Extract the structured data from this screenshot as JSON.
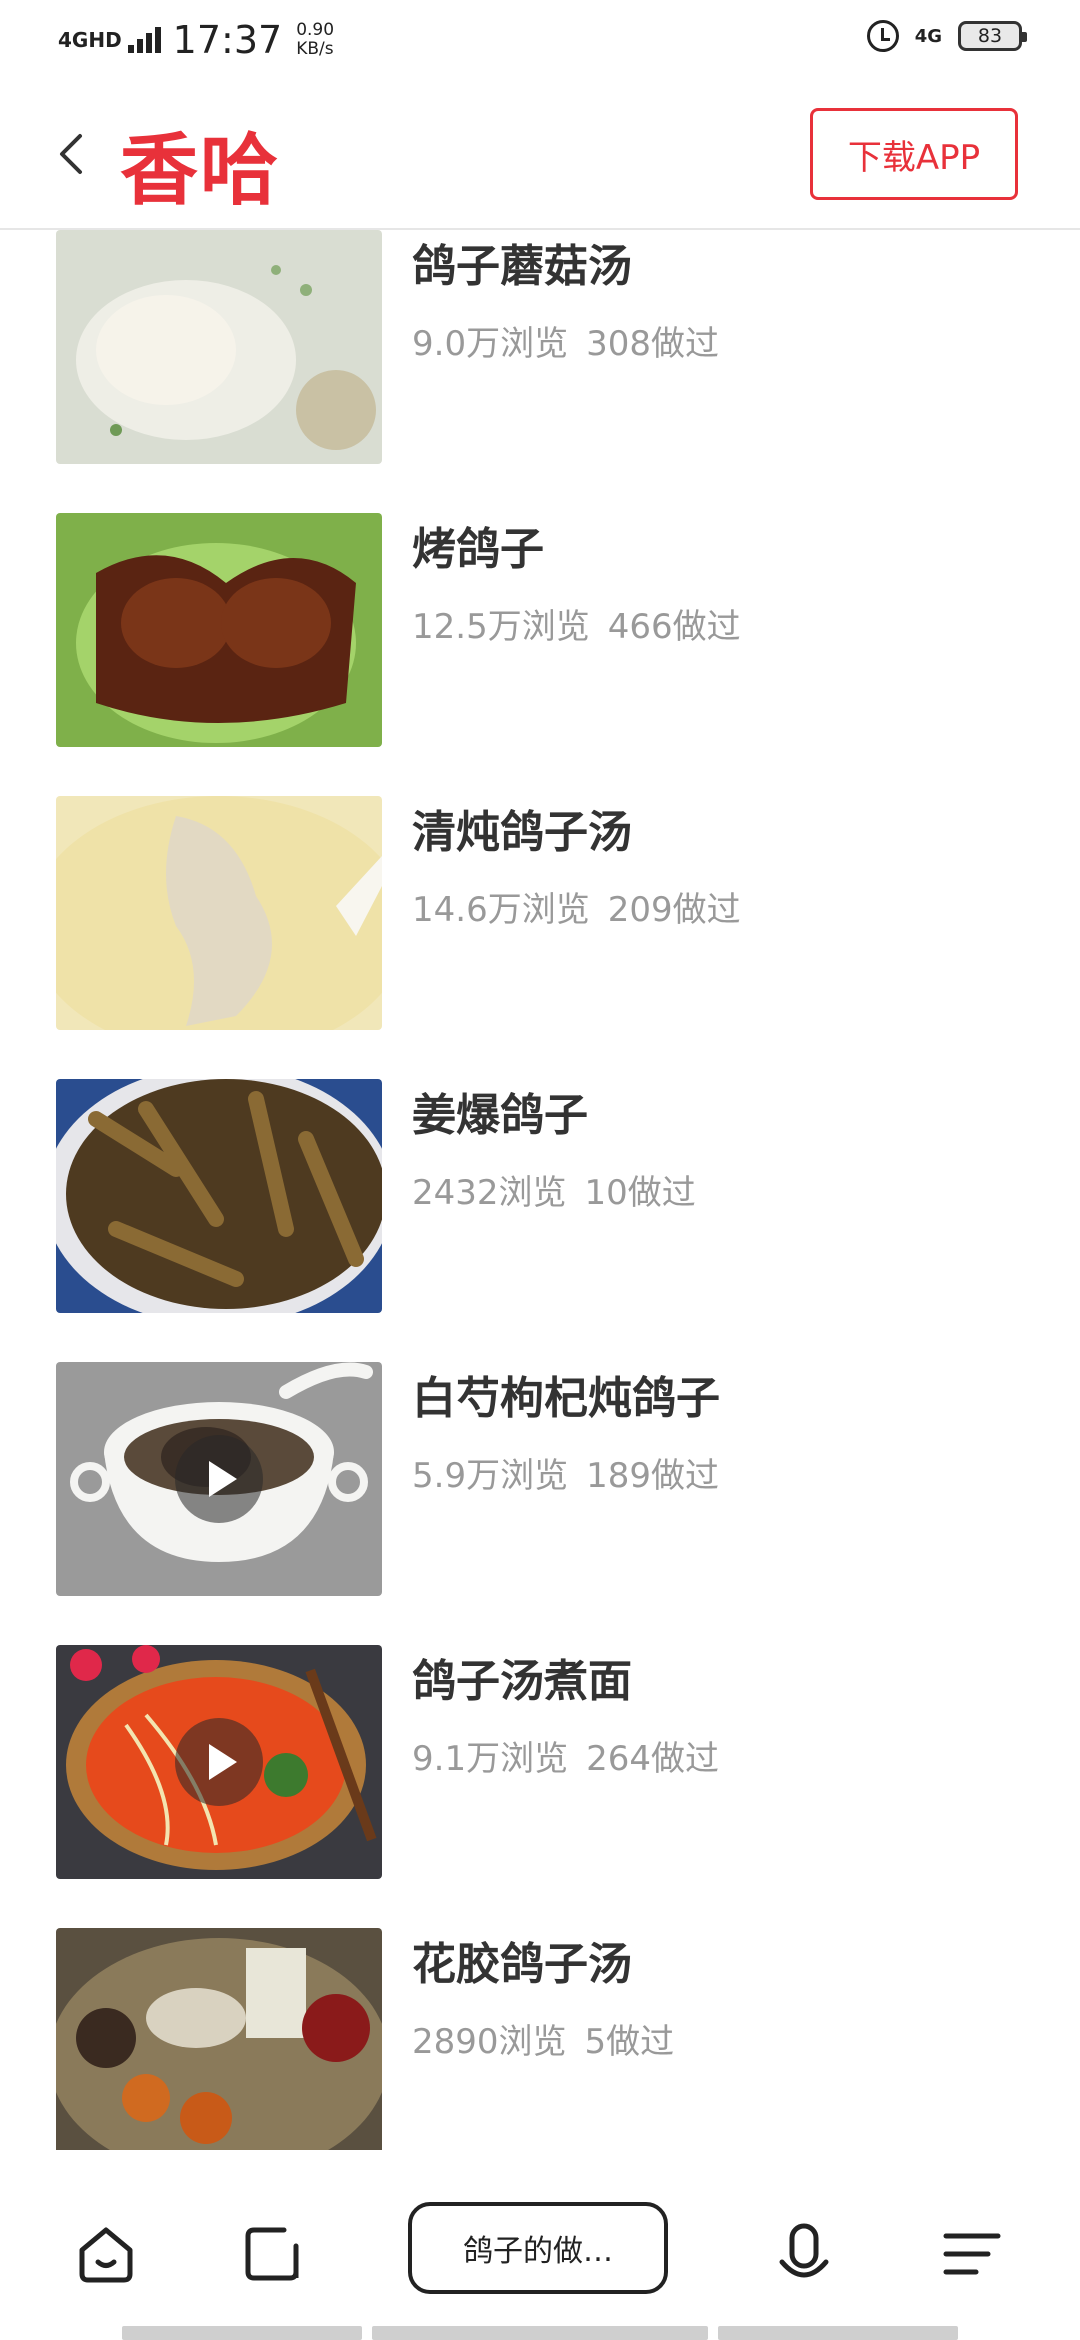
{
  "status_bar": {
    "network": "4GHD",
    "time": "17:37",
    "speed_value": "0.90",
    "speed_unit": "KB/s",
    "network_right": "4G",
    "battery": "83"
  },
  "header": {
    "logo": "香哈",
    "download_label": "下载APP"
  },
  "recipes": [
    {
      "title": "鸽子蘑菇汤",
      "views": "9.0万浏览",
      "made": "308做过",
      "video": false,
      "thumb": "soup-light"
    },
    {
      "title": "烤鸽子",
      "views": "12.5万浏览",
      "made": "466做过",
      "video": false,
      "thumb": "roast"
    },
    {
      "title": "清炖鸽子汤",
      "views": "14.6万浏览",
      "made": "209做过",
      "video": false,
      "thumb": "broth"
    },
    {
      "title": "姜爆鸽子",
      "views": "2432浏览",
      "made": "10做过",
      "video": false,
      "thumb": "stirfry"
    },
    {
      "title": "白芍枸杞炖鸽子",
      "views": "5.9万浏览",
      "made": "189做过",
      "video": true,
      "thumb": "bowl"
    },
    {
      "title": "鸽子汤煮面",
      "views": "9.1万浏览",
      "made": "264做过",
      "video": true,
      "thumb": "noodle"
    },
    {
      "title": "花胶鸽子汤",
      "views": "2890浏览",
      "made": "5做过",
      "video": false,
      "thumb": "mixed"
    }
  ],
  "bottom_bar": {
    "search_text": "鸽子的做…",
    "icons": [
      "home-icon",
      "tabs-icon",
      "microphone-icon",
      "menu-icon"
    ]
  },
  "colors": {
    "brand": "#e8313a",
    "meta_text": "#999999",
    "title_text": "#333333"
  }
}
